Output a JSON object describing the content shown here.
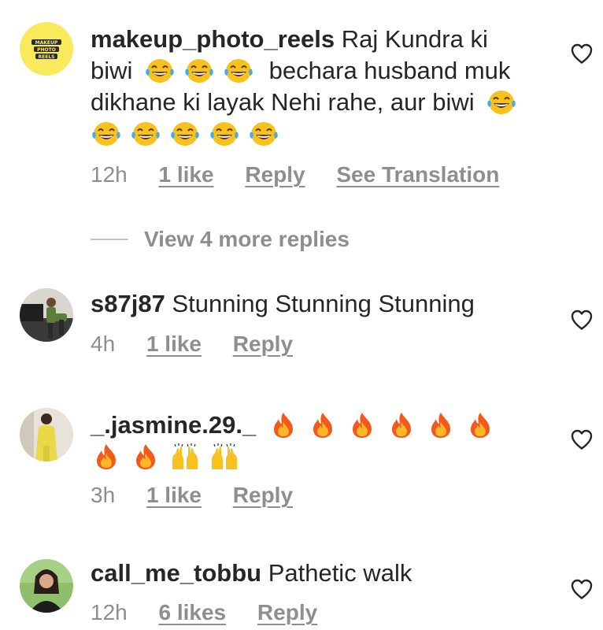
{
  "comments": [
    {
      "username": "makeup_photo_reels",
      "avatar": {
        "icon": "makeup-photo-reels-logo",
        "label": "MAKEUP PHOTO REELS",
        "bg": "#f8ea5a"
      },
      "text_parts": [
        "Raj Kundra ki biwi",
        "bechara husband muk dikhane ki layak Nehi rahe, aur biwi"
      ],
      "emojis_1": [
        "face-with-tears-of-joy",
        "face-with-tears-of-joy",
        "face-with-tears-of-joy"
      ],
      "emojis_2": [
        "face-with-tears-of-joy",
        "face-with-tears-of-joy",
        "face-with-tears-of-joy",
        "face-with-tears-of-joy",
        "face-with-tears-of-joy",
        "face-with-tears-of-joy"
      ],
      "time": "12h",
      "likes": "1 like",
      "reply": "Reply",
      "translation": "See Translation"
    },
    {
      "username": "s87j87",
      "text": "Stunning Stunning Stunning",
      "time": "4h",
      "likes": "1 like",
      "reply": "Reply"
    },
    {
      "username": "_.jasmine.29._",
      "emojis": [
        "fire",
        "fire",
        "fire",
        "fire",
        "fire",
        "fire",
        "fire",
        "fire",
        "raising-hands",
        "raising-hands"
      ],
      "time": "3h",
      "likes": "1 like",
      "reply": "Reply"
    },
    {
      "username": "call_me_tobbu",
      "text": "Pathetic walk",
      "time": "12h",
      "likes": "6 likes",
      "reply": "Reply"
    }
  ],
  "view_more": "View 4 more replies",
  "colors": {
    "text": "#262626",
    "secondary": "#8e8e8e",
    "divider": "#c7c7c7"
  },
  "icons": {
    "like": "heart-outline-icon"
  }
}
